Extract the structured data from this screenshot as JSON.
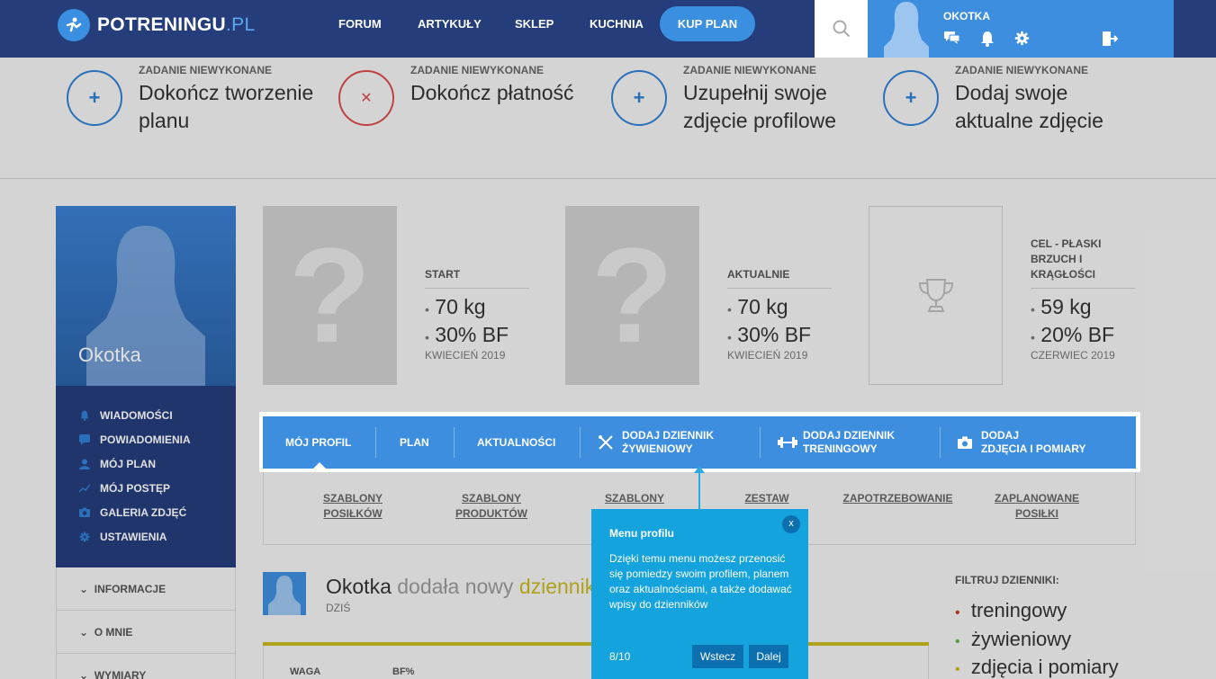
{
  "header": {
    "logo": {
      "brand": "POTRENINGU",
      "tld": ".PL"
    },
    "nav": [
      "FORUM",
      "ARTYKUŁY",
      "SKLEP",
      "KUCHNIA"
    ],
    "cta": "KUP PLAN",
    "user": {
      "name": "OKOTKA"
    }
  },
  "tasks": [
    {
      "status": "ZADANIE NIEWYKONANE",
      "line1": "Dokończ tworzenie",
      "line2": "planu",
      "icon": "plus-icon"
    },
    {
      "status": "ZADANIE NIEWYKONANE",
      "line1": "Dokończ płatność",
      "line2": "",
      "icon": "x-icon"
    },
    {
      "status": "ZADANIE NIEWYKONANE",
      "line1": "Uzupełnij swoje",
      "line2": "zdjęcie profilowe",
      "icon": "plus-icon"
    },
    {
      "status": "ZADANIE NIEWYKONANE",
      "line1": "Dodaj swoje",
      "line2": "aktualne zdjęcie",
      "icon": "plus-icon"
    }
  ],
  "sidebar": {
    "name": "Okotka",
    "items": [
      {
        "label": "WIADOMOŚCI",
        "icon": "bell-icon"
      },
      {
        "label": "POWIADOMIENIA",
        "icon": "chat-icon"
      },
      {
        "label": "MÓJ PLAN",
        "icon": "user-icon"
      },
      {
        "label": "MÓJ POSTĘP",
        "icon": "chart-icon"
      },
      {
        "label": "GALERIA ZDJĘĆ",
        "icon": "camera-icon"
      },
      {
        "label": "USTAWIENIA",
        "icon": "gear-icon"
      }
    ],
    "accordion": [
      "INFORMACJE",
      "O MNIE",
      "WYMIARY"
    ]
  },
  "stats": [
    {
      "label1": "START",
      "label2": "",
      "label3": "",
      "kg": "70 kg",
      "bf": "30% BF",
      "date": "KWIECIEŃ 2019"
    },
    {
      "label1": "AKTUALNIE",
      "label2": "",
      "label3": "",
      "kg": "70 kg",
      "bf": "30% BF",
      "date": "KWIECIEŃ 2019"
    },
    {
      "label1": "CEL - PŁASKI",
      "label2": "BRZUCH I",
      "label3": "KRĄGŁOŚCI",
      "kg": "59 kg",
      "bf": "20% BF",
      "date": "CZERWIEC 2019"
    }
  ],
  "tabs": [
    {
      "label": "MÓJ PROFIL"
    },
    {
      "label": "PLAN"
    },
    {
      "label": "AKTUALNOŚCI"
    },
    {
      "line1": "DODAJ DZIENNIK",
      "line2": "ŻYWIENIOWY",
      "icon": "utensils-icon"
    },
    {
      "line1": "DODAJ DZIENNIK",
      "line2": "TRENINGOWY",
      "icon": "dumbbell-icon"
    },
    {
      "line1": "DODAJ",
      "line2": "ZDJĘCIA I POMIARY",
      "icon": "camera-icon"
    }
  ],
  "submenu": [
    {
      "line1": "SZABLONY",
      "line2": "POSIŁKÓW"
    },
    {
      "line1": "SZABLONY",
      "line2": "PRODUKTÓW"
    },
    {
      "line1": "SZABLONY",
      "line2": ""
    },
    {
      "line1": "ZESTAW",
      "line2": ""
    },
    {
      "line1": "ZAPOTRZEBOWANIE",
      "line2": ""
    },
    {
      "line1": "ZAPLANOWANE",
      "line2": "POSIŁKI"
    }
  ],
  "feed": {
    "author": "Okotka",
    "action": " dodała nowy ",
    "highlight": "dziennik",
    "time": "DZIŚ",
    "col1": "WAGA",
    "col2": "BF%"
  },
  "filter": {
    "title": "FILTRUJ DZIENNIKI:",
    "items": [
      {
        "label": "treningowy",
        "color": "#c0392b"
      },
      {
        "label": "żywieniowy",
        "color": "#6ab04c"
      },
      {
        "label": "zdjęcia i pomiary",
        "color": "#c8b820"
      }
    ]
  },
  "tooltip": {
    "title": "Menu profilu",
    "text": "Dzięki temu menu możesz przenosić się pomiedzy swoim profilem, planem oraz aktualnościami, a także dodawać wpisy do dzienników",
    "step": "8/10",
    "close": "x",
    "back": "Wstecz",
    "next": "Dalej"
  },
  "colors": {
    "navy": "#253d7b",
    "blue": "#3d8edf",
    "tooltip": "#14a3dc"
  }
}
